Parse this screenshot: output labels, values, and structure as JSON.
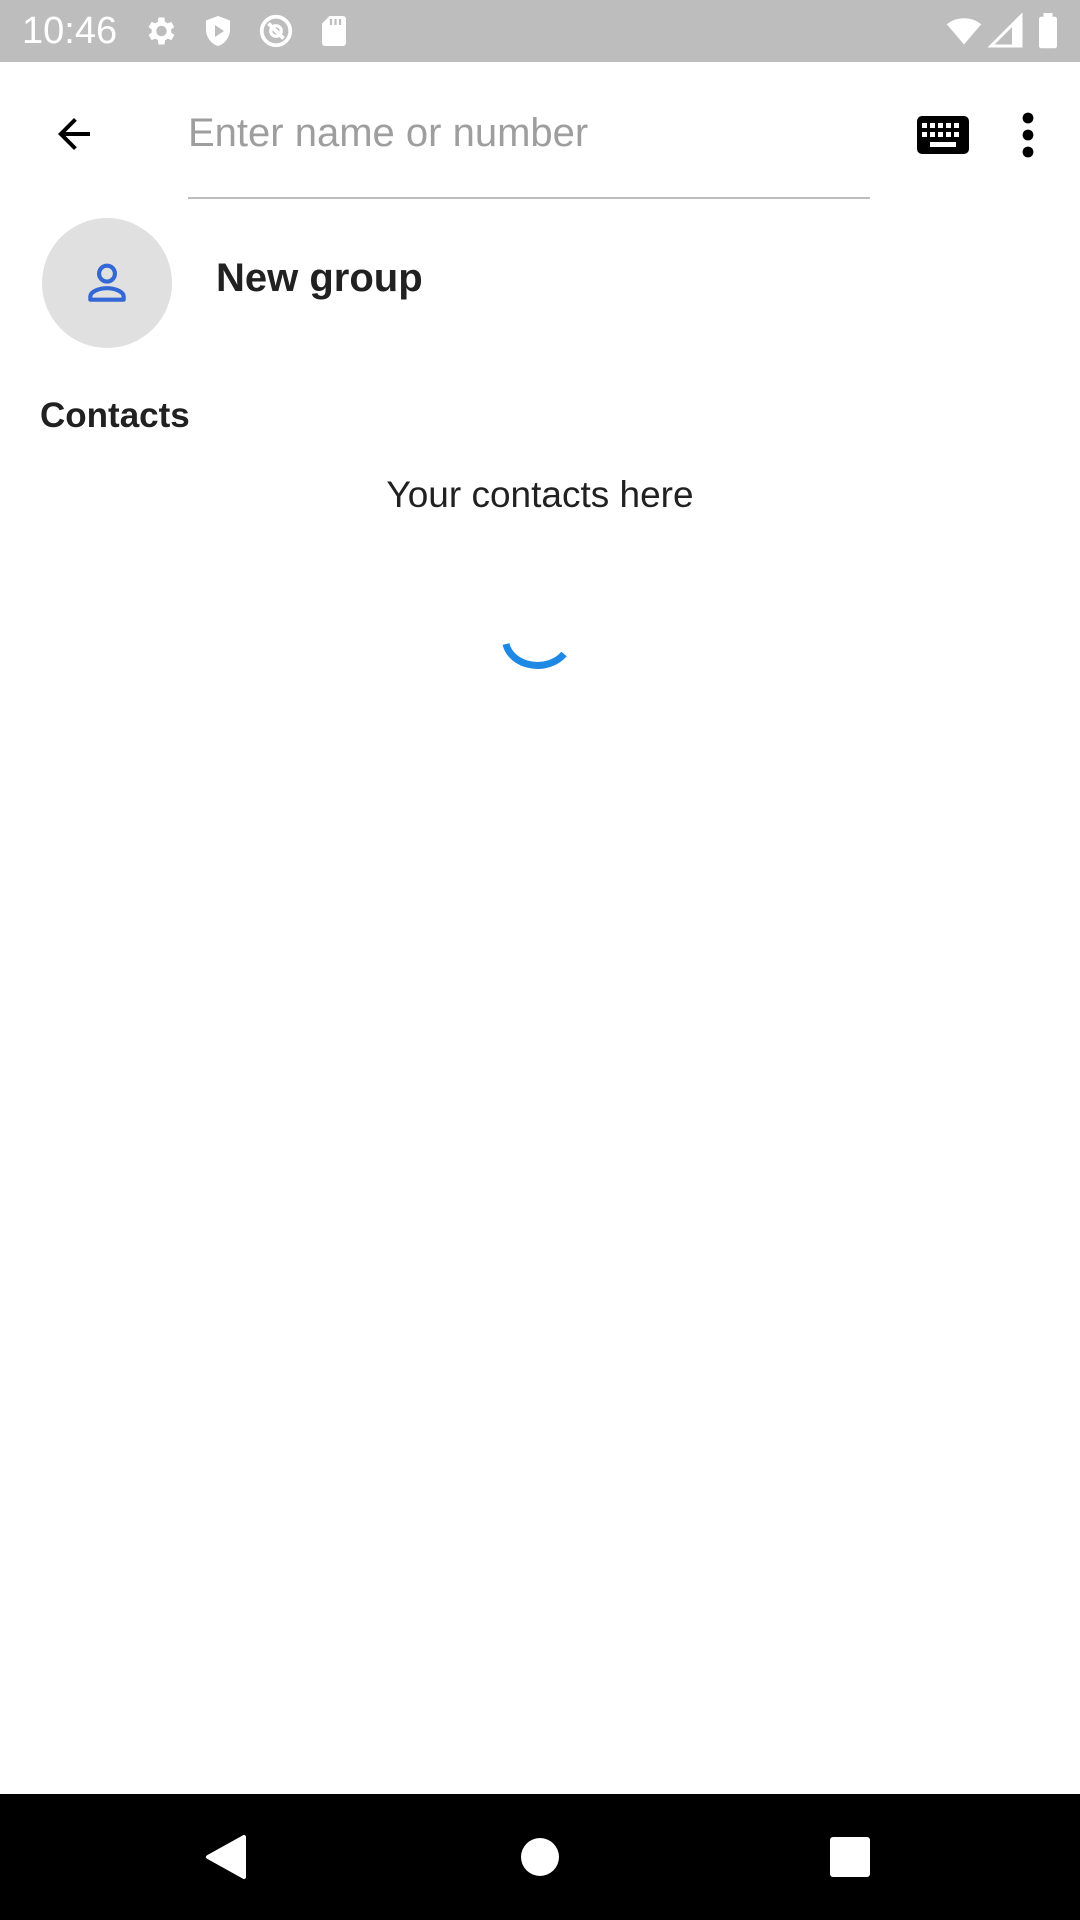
{
  "status_bar": {
    "time": "10:46",
    "icons": [
      "settings-icon",
      "shield-play-icon",
      "at-sign-icon",
      "sd-card-icon",
      "wifi-icon",
      "signal-icon",
      "battery-icon"
    ]
  },
  "app_bar": {
    "back_icon": "arrow-back-icon",
    "search_placeholder": "Enter name or number",
    "search_value": "",
    "keyboard_icon": "keyboard-icon",
    "more_icon": "more-vert-icon"
  },
  "new_group": {
    "label": "New group",
    "icon": "person-icon"
  },
  "contacts": {
    "header": "Contacts",
    "empty_message": "Your contacts here"
  },
  "nav_bar": {
    "icons": [
      "nav-back-icon",
      "nav-home-icon",
      "nav-recents-icon"
    ]
  },
  "colors": {
    "accent": "#1e88e5",
    "avatar_bg": "#e0e0e0",
    "person_icon": "#3367d6",
    "status_bar_bg": "#bdbdbd",
    "nav_bar_bg": "#000000"
  }
}
